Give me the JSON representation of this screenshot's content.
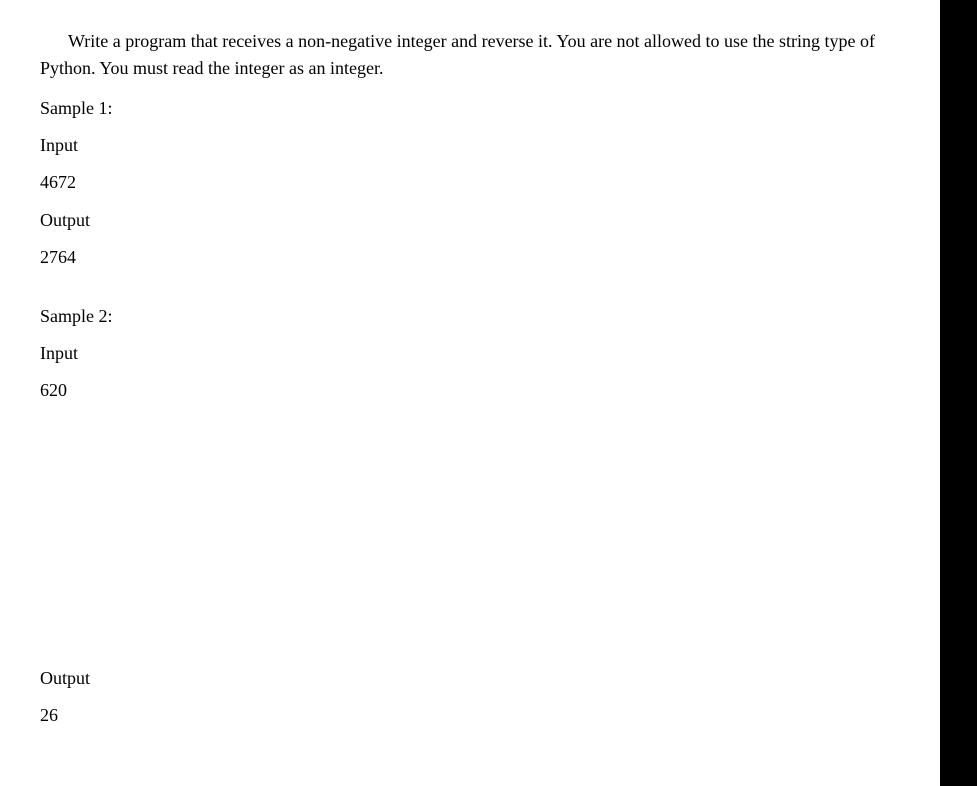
{
  "problem": {
    "statement": "Write a program that receives a non-negative integer and reverse it. You are not allowed to use the string type of Python. You must read the integer as an integer."
  },
  "samples": [
    {
      "title": "Sample 1:",
      "input_label": "Input",
      "input_value": "4672",
      "output_label": "Output",
      "output_value": "2764"
    },
    {
      "title": "Sample 2:",
      "input_label": "Input",
      "input_value": "620",
      "output_label": "Output",
      "output_value": "26"
    }
  ]
}
